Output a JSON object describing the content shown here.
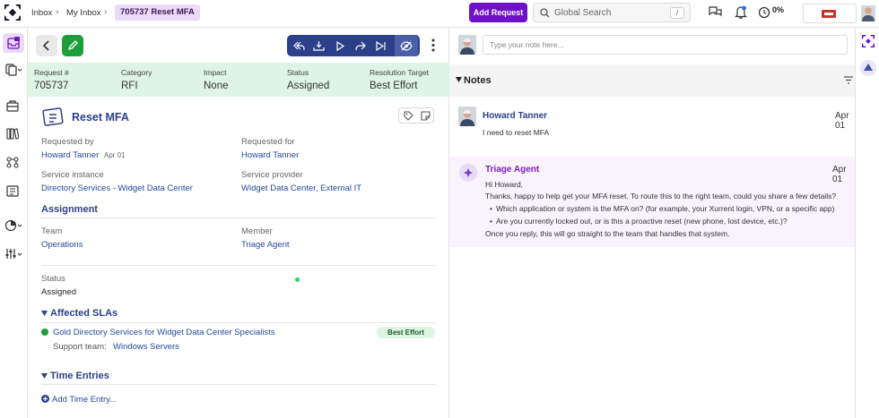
{
  "breadcrumb": {
    "inbox": "Inbox",
    "my_inbox": "My Inbox",
    "current": "705737 Reset MFA"
  },
  "header": {
    "add_request": "Add Request",
    "search_placeholder": "Global Search",
    "search_shortcut": "/",
    "progress": "0%"
  },
  "info": {
    "request_no_label": "Request #",
    "request_no": "705737",
    "category_label": "Category",
    "category": "RFI",
    "impact_label": "Impact",
    "impact": "None",
    "status_label": "Status",
    "status": "Assigned",
    "target_label": "Resolution Target",
    "target": "Best Effort"
  },
  "request": {
    "title": "Reset MFA",
    "requested_by_label": "Requested by",
    "requested_by": "Howard Tanner",
    "requested_by_date": "Apr 01",
    "requested_for_label": "Requested for",
    "requested_for": "Howard Tanner",
    "service_instance_label": "Service instance",
    "service_instance": "Directory Services - Widget Data Center",
    "service_provider_label": "Service provider",
    "service_provider": "Widget Data Center, External IT",
    "assignment_title": "Assignment",
    "team_label": "Team",
    "team": "Operations",
    "member_label": "Member",
    "member": "Triage Agent",
    "status_label": "Status",
    "status": "Assigned",
    "slas_title": "Affected SLAs",
    "sla_name": "Gold Directory Services for Widget Data Center Specialists",
    "sla_badge": "Best Effort",
    "support_team_label": "Support team:",
    "support_team": "Windows Servers",
    "time_entries_title": "Time Entries",
    "add_time_entry": "Add Time Entry..."
  },
  "notes": {
    "input_placeholder": "Type your note here...",
    "title": "Notes",
    "items": [
      {
        "author": "Howard Tanner",
        "date": "Apr 01",
        "lines": [
          "I need to reset MFA"
        ]
      },
      {
        "author": "Triage Agent",
        "date": "Apr 01",
        "lines": [
          "Hi Howard,",
          "Thanks, happy to help get your MFA reset. To route this to the right team, could you share a few details?",
          "Which application or system is the MFA on? (for example, your Xurrent login, VPN, or a specific app)",
          "Are you currently locked out, or is this a proactive reset (new phone, lost device, etc.)?",
          "Once you reply, this will go straight to the team that handles that system."
        ]
      }
    ]
  },
  "colors": {
    "accent": "#6f11c9",
    "navy": "#2b3f8a",
    "link": "#234a9c",
    "green": "#1e9e3a",
    "info_bg": "#dff5e3"
  }
}
